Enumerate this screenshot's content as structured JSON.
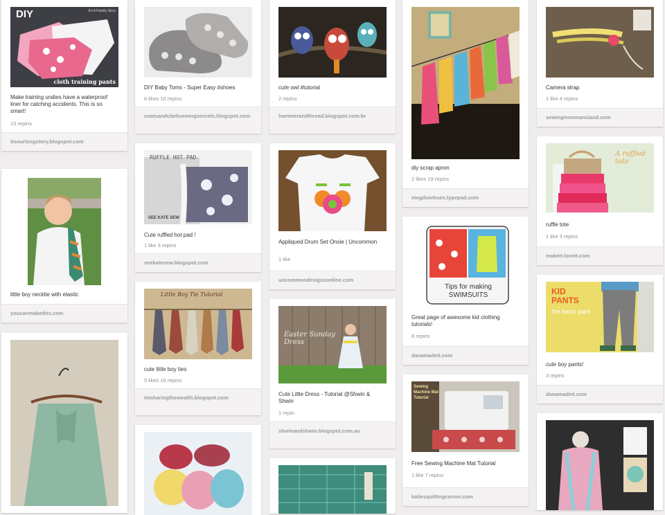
{
  "pins": [
    {
      "caption": "Make training undies have a waterproof liner for catching accidents. This is so smart!",
      "stats": "13 repins",
      "source": "itsourlongstory.blogspot.com",
      "overlay_diy": "DIY",
      "overlay_sub": "cloth training pants",
      "overlay_brand": "It's A Family Story"
    },
    {
      "caption": "little boy necktie with elastic",
      "stats": "",
      "source": "youcanmakethis.com"
    },
    {
      "caption": "",
      "stats": "",
      "source": ""
    },
    {
      "caption": "DIY Baby Toms - Super Easy #shoes",
      "stats": "6 likes  10 repins",
      "source": "coatsandclarksewingsecrets.blogspot.com"
    },
    {
      "caption": "Cute ruffled hot pad !",
      "stats": "1 like  3 repins",
      "source": "seekatesew.blogspot.com",
      "overlay_title": "RUFFLE HOT PAD",
      "overlay_brand": "SEE KATE SEW"
    },
    {
      "caption": "cute little boy ties",
      "stats": "5 likes  16 repins",
      "source": "imsharingthewealth.blogspot.com",
      "overlay_title": "Little Boy Tie Tutorial"
    },
    {
      "caption": "",
      "stats": "",
      "source": ""
    },
    {
      "caption": "cute owl #tutorial",
      "stats": "2 repins",
      "source": "hammerandthread.blogspot.com.br"
    },
    {
      "caption": "Appliqued Drum Set Onsie | Uncommon",
      "stats": "1 like",
      "source": "uncommondesignsonline.com"
    },
    {
      "caption": "Cute Little Dress - Tutorial @Shwin & Shwin",
      "stats": "1 repin",
      "source": "shwinandshwin.blogspot.com.au",
      "overlay_title": "Easter Sunday Dress"
    },
    {
      "caption": "",
      "stats": "",
      "source": ""
    },
    {
      "caption": "diy scrap apron",
      "stats": "2 likes  19 repins",
      "source": "megduerksen.typepad.com"
    },
    {
      "caption": "Great page of awesome kid clothing tutorials!",
      "stats": "8 repins",
      "source": "danamadeit.com",
      "overlay_title": "Tips for making SWIMSUITS"
    },
    {
      "caption": "Free Sewing Machine Mat Tutorial",
      "stats": "1 like  7 repins",
      "source": "katiesquiltingcorner.com",
      "overlay_title": "Sewing Machine Mat Tutorial"
    },
    {
      "caption": "Camera strap",
      "stats": "1 like  4 repins",
      "source": "sewinginnomansland.com"
    },
    {
      "caption": "ruffle tote",
      "stats": "1 like  3 repins",
      "source": "makeit-loveit.com",
      "overlay_title": "A ruffled tote"
    },
    {
      "caption": "cute boy pants!",
      "stats": "3 repins",
      "source": "danamadeit.com",
      "overlay_title": "KID PANTS",
      "overlay_sub": "the basic pant"
    },
    {
      "caption": "",
      "stats": "",
      "source": ""
    }
  ],
  "colors": {
    "page_bg": "#efeded",
    "card_bg": "#ffffff",
    "source_bg": "#f4f2f2",
    "text": "#333333",
    "muted": "#8c8c8c"
  }
}
